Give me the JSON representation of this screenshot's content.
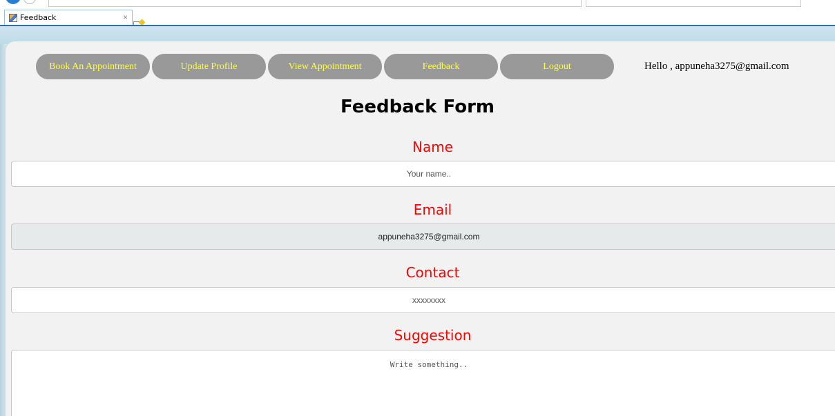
{
  "browser": {
    "tab_title": "Feedback",
    "tab_close": "×"
  },
  "nav": {
    "items": [
      {
        "label": "Book An Appointment"
      },
      {
        "label": "Update Profile"
      },
      {
        "label": "View Appointment"
      },
      {
        "label": "Feedback"
      },
      {
        "label": "Logout"
      }
    ],
    "greeting": "Hello , appuneha3275@gmail.com",
    "button_color": "#999999",
    "label_color": "#ffff33"
  },
  "form": {
    "title": "Feedback Form",
    "label_color": "#ff0000",
    "name": {
      "label": "Name",
      "placeholder": "Your name.."
    },
    "email": {
      "label": "Email",
      "value": "appuneha3275@gmail.com"
    },
    "contact": {
      "label": "Contact",
      "placeholder": "xxxxxxxx"
    },
    "suggestion": {
      "label": "Suggestion",
      "placeholder": "Write something.."
    }
  }
}
